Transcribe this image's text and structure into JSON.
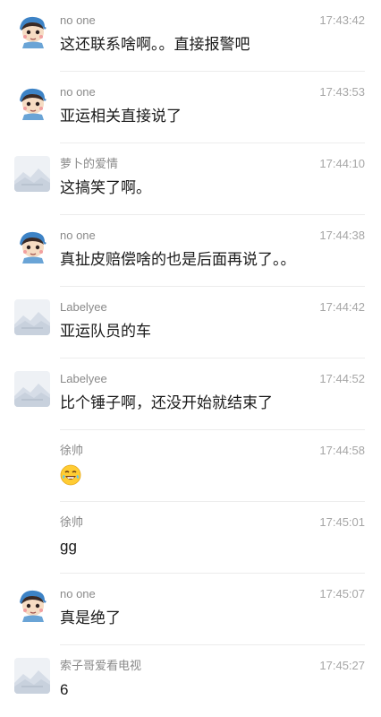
{
  "messages": [
    {
      "name": "no one",
      "time": "17:43:42",
      "text": "这还联系啥啊。。直接报警吧",
      "avatar": "cartoon-boy"
    },
    {
      "name": "no one",
      "time": "17:43:53",
      "text": "亚运相关直接说了",
      "avatar": "cartoon-boy"
    },
    {
      "name": "萝卜的爱情",
      "time": "17:44:10",
      "text": "这搞笑了啊。",
      "avatar": "placeholder-image"
    },
    {
      "name": "no one",
      "time": "17:44:38",
      "text": "真扯皮赔偿啥的也是后面再说了。。",
      "avatar": "cartoon-boy"
    },
    {
      "name": "Labelyee",
      "time": "17:44:42",
      "text": "亚运队员的车",
      "avatar": "placeholder-image"
    },
    {
      "name": "Labelyee",
      "time": "17:44:52",
      "text": "比个锤子啊，还没开始就结束了",
      "avatar": "placeholder-image"
    },
    {
      "name": "徐帅",
      "time": "17:44:58",
      "text": "",
      "avatar": "none",
      "emoji": "laughing-tears-emoji"
    },
    {
      "name": "徐帅",
      "time": "17:45:01",
      "text": "gg",
      "avatar": "none"
    },
    {
      "name": "no one",
      "time": "17:45:07",
      "text": "真是绝了",
      "avatar": "cartoon-boy"
    },
    {
      "name": "索子哥爱看电视",
      "time": "17:45:27",
      "text": "6",
      "avatar": "placeholder-image"
    }
  ],
  "colors": {
    "name": "#8a8a8a",
    "time": "#a6a6a6",
    "text": "#1a1a1a",
    "divider": "#ececec"
  }
}
